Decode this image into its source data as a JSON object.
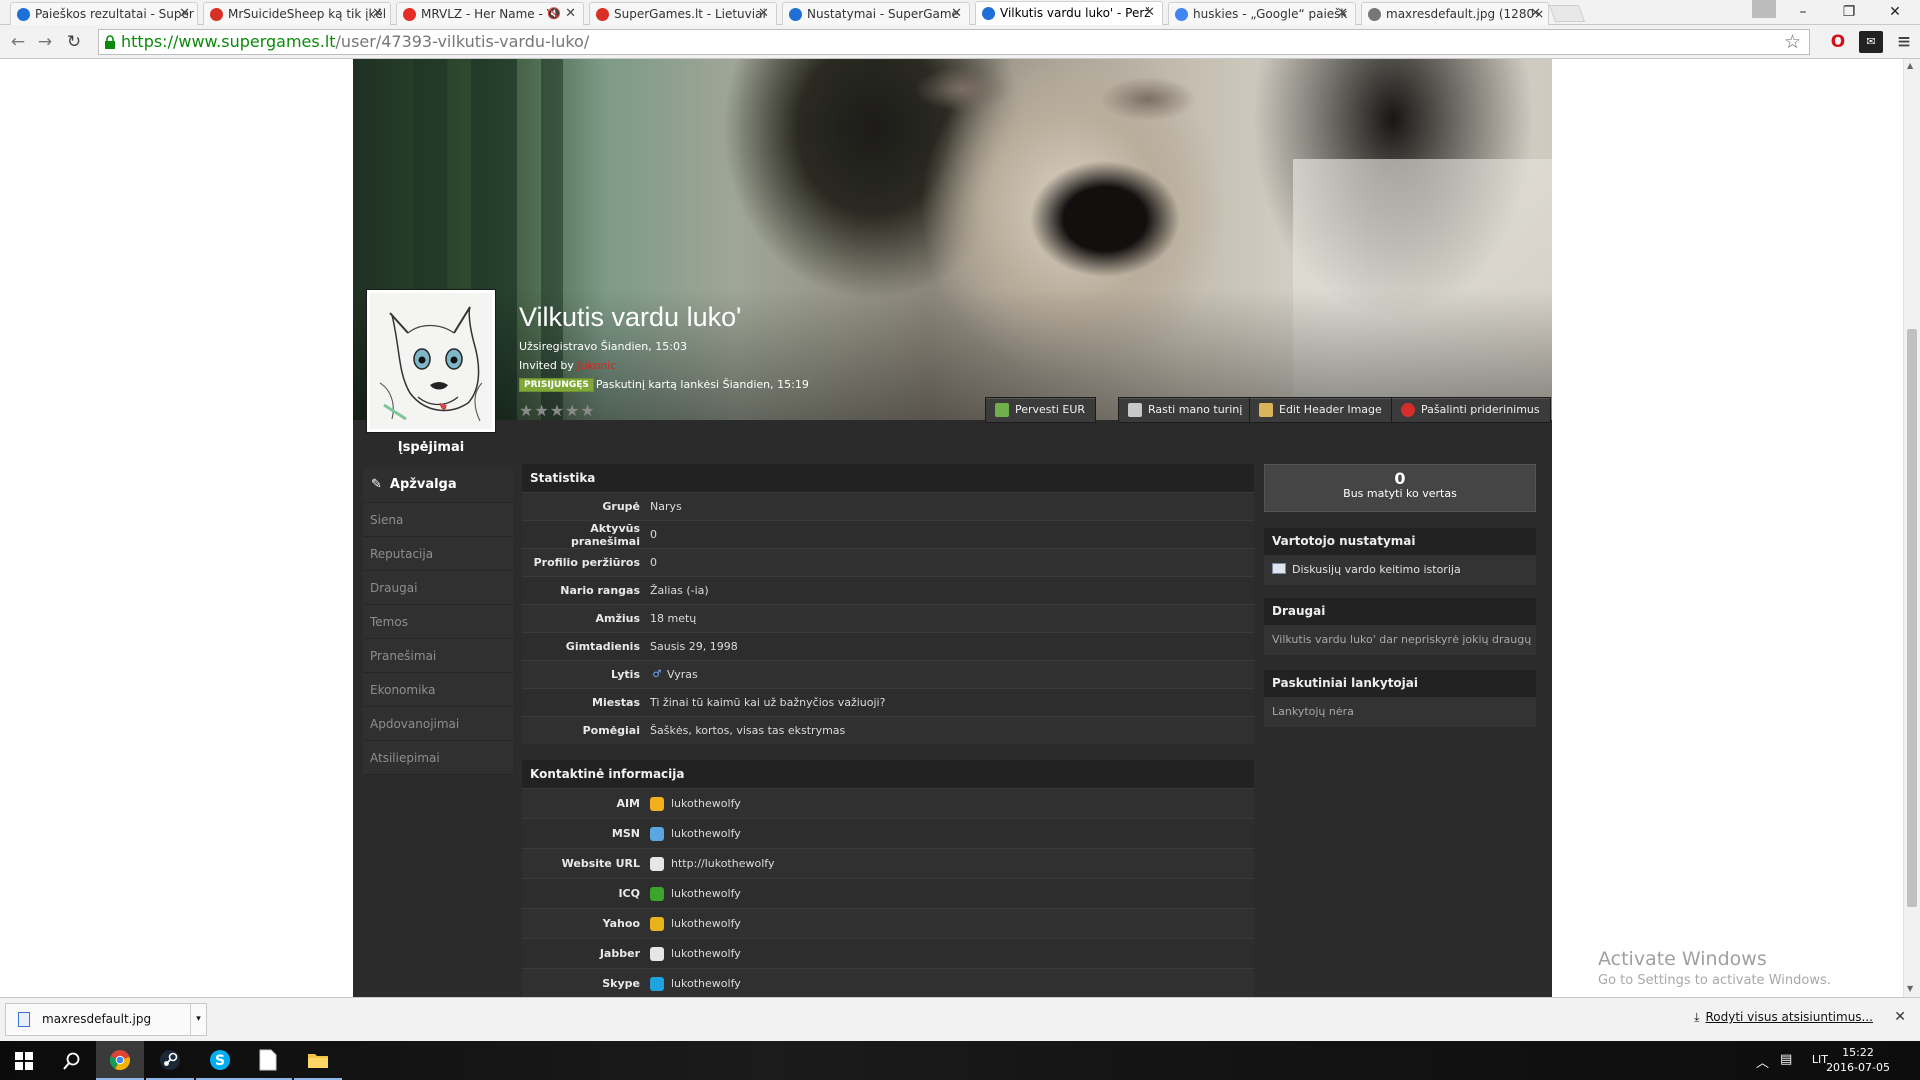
{
  "browser": {
    "tabs": [
      {
        "title": "Paieškos rezultatai - Super",
        "favicon": "supergames-icon",
        "color": "#1e6fd6",
        "active": false
      },
      {
        "title": "MrSuicideSheep ką tik įkėl",
        "favicon": "gmail-icon",
        "color": "#d93025",
        "active": false
      },
      {
        "title": "MRVLZ - Her Name - Y",
        "favicon": "youtube-icon",
        "color": "#e52d27",
        "active": false,
        "muted": true
      },
      {
        "title": "SuperGames.lt - Lietuviai",
        "favicon": "gmail-icon",
        "color": "#d93025",
        "active": false
      },
      {
        "title": "Nustatymai - SuperGame",
        "favicon": "supergames-icon",
        "color": "#1e6fd6",
        "active": false
      },
      {
        "title": "Vilkutis vardu luko' - Perž",
        "favicon": "supergames-icon",
        "color": "#1e6fd6",
        "active": true
      },
      {
        "title": "huskies - „Google“ paiešk",
        "favicon": "google-icon",
        "color": "#4285f4",
        "active": false
      },
      {
        "title": "maxresdefault.jpg (1280×",
        "favicon": "document-icon",
        "color": "#777777",
        "active": false
      }
    ],
    "url_host": "https://www.supergames.lt",
    "url_path": "/user/47393-vilkutis-vardu-luko/"
  },
  "profile": {
    "username": "Vilkutis vardu luko'",
    "registered": "Užsiregistravo Šiandien, 15:03",
    "invited_prefix": "Invited by",
    "inviter": "Jukonic",
    "online_badge": "PRISIJUNGĘS",
    "last_visit": "Paskutinį kartą lankėsi Šiandien, 15:19",
    "rating_stars": 5,
    "warnings_label": "Įspėjimai",
    "buttons": [
      {
        "label": "Pervesti EUR",
        "icon": "money-transfer-icon",
        "color": "#6fb04a"
      },
      {
        "label": "Rasti mano turinį",
        "icon": "find-content-icon",
        "color": "#c8c8c8"
      },
      {
        "label": "Edit Header Image",
        "icon": "image-edit-icon",
        "color": "#d8b45a"
      },
      {
        "label": "Pašalinti priderinimus",
        "icon": "remove-icon",
        "color": "#d62c2c"
      }
    ]
  },
  "menu": {
    "items": [
      {
        "label": "Apžvalga",
        "active": true
      },
      {
        "label": "Siena"
      },
      {
        "label": "Reputacija"
      },
      {
        "label": "Draugai"
      },
      {
        "label": "Temos"
      },
      {
        "label": "Pranešimai"
      },
      {
        "label": "Ekonomika"
      },
      {
        "label": "Apdovanojimai"
      },
      {
        "label": "Atsiliepimai"
      }
    ]
  },
  "stats": {
    "title": "Statistika",
    "rows": [
      {
        "label": "Grupė",
        "value": "Narys"
      },
      {
        "label": "Aktyvūs pranešimai",
        "value": "0"
      },
      {
        "label": "Profilio peržiūros",
        "value": "0"
      },
      {
        "label": "Nario rangas",
        "value": "Žalias (-ia)"
      },
      {
        "label": "Amžius",
        "value": "18 metų"
      },
      {
        "label": "Gimtadienis",
        "value": "Sausis 29, 1998"
      },
      {
        "label": "Lytis",
        "value": "Vyras",
        "icon": "male-icon"
      },
      {
        "label": "Miestas",
        "value": "Ti žinai tū kaimū kai už bažnyčios važiuoji?"
      },
      {
        "label": "Pomėgiai",
        "value": "Šaškės, kortos, visas tas ekstrymas"
      }
    ]
  },
  "contact": {
    "title": "Kontaktinė informacija",
    "rows": [
      {
        "label": "AIM",
        "value": "lukothewolfy",
        "icon": "aim-icon",
        "color": "#f2b01e"
      },
      {
        "label": "MSN",
        "value": "lukothewolfy",
        "icon": "msn-icon",
        "color": "#5aa6de"
      },
      {
        "label": "Website URL",
        "value": "http://lukothewolfy",
        "icon": "website-icon",
        "color": "#e6e6e6"
      },
      {
        "label": "ICQ",
        "value": "lukothewolfy",
        "icon": "icq-icon",
        "color": "#3aa52a"
      },
      {
        "label": "Yahoo",
        "value": "lukothewolfy",
        "icon": "yahoo-icon",
        "color": "#e9b21a"
      },
      {
        "label": "Jabber",
        "value": "lukothewolfy",
        "icon": "jabber-icon",
        "color": "#e6e6e6"
      },
      {
        "label": "Skype",
        "value": "lukothewolfy",
        "icon": "skype-icon",
        "color": "#1fa2e0"
      }
    ]
  },
  "sidebar": {
    "reputation_count": "0",
    "reputation_text": "Bus matyti ko vertas",
    "settings_title": "Vartotojo nustatymai",
    "settings_link": "Diskusijų vardo keitimo istorija",
    "friends_title": "Draugai",
    "friends_empty": "Vilkutis vardu luko' dar nepriskyrė jokių draugų",
    "visitors_title": "Paskutiniai lankytojai",
    "visitors_empty": "Lankytojų nėra"
  },
  "watermark": {
    "line1": "Activate Windows",
    "line2": "Go to Settings to activate Windows."
  },
  "downloads": {
    "file": "maxresdefault.jpg",
    "show_all": "Rodyti visus atsisiuntimus..."
  },
  "taskbar": {
    "lang": "LIT",
    "time": "15:22",
    "date": "2016-07-05"
  }
}
